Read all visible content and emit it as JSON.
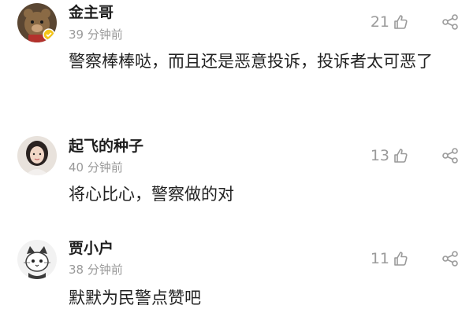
{
  "comments": [
    {
      "username": "金主哥",
      "time": "39 分钟前",
      "text": "警察棒棒哒，而且还是恶意投诉，投诉者太可恶了",
      "likes": "21",
      "avatar_icon": "teddy-bear-avatar"
    },
    {
      "username": "起飞的种子",
      "time": "40 分钟前",
      "text": "将心比心，警察做的对",
      "likes": "13",
      "avatar_icon": "girl-portrait-avatar"
    },
    {
      "username": "贾小户",
      "time": "38 分钟前",
      "text": "默默为民警点赞吧",
      "likes": "11",
      "avatar_icon": "cartoon-cat-avatar"
    }
  ],
  "colors": {
    "meta_gray": "#9a9a9a",
    "text_dark": "#222222",
    "badge_yellow": "#f5c518"
  }
}
